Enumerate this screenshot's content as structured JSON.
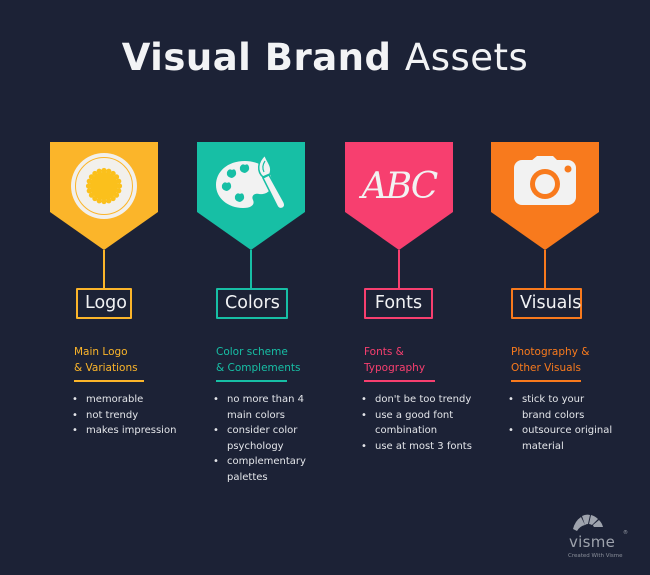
{
  "title": {
    "bold": "Visual Brand",
    "light": "Assets"
  },
  "colors": {
    "background": "#1c2236",
    "logo": "#fbb52a",
    "colors": "#17bfa5",
    "fonts": "#f73f6f",
    "visuals": "#f87a1d",
    "icon_white": "#f2f2f2"
  },
  "columns": [
    {
      "key": "logo",
      "icon": "sun-badge-icon",
      "label": "Logo",
      "subtitle_line1": "Main Logo",
      "subtitle_line2": "& Variations",
      "bullets": [
        "memorable",
        "not trendy",
        "makes impression"
      ]
    },
    {
      "key": "colors",
      "icon": "paint-palette-icon",
      "label": "Colors",
      "subtitle_line1": "Color scheme",
      "subtitle_line2": "& Complements",
      "bullets": [
        "no more than 4 main colors",
        "consider color psychology",
        "complementary palettes"
      ]
    },
    {
      "key": "fonts",
      "icon": "abc-text-icon",
      "icon_text": "ABC",
      "label": "Fonts",
      "subtitle_line1": "Fonts &",
      "subtitle_line2": "Typography",
      "bullets": [
        "don't be too trendy",
        "use a good font combination",
        "use at most 3 fonts"
      ]
    },
    {
      "key": "visuals",
      "icon": "camera-icon",
      "label": "Visuals",
      "subtitle_line1": "Photography &",
      "subtitle_line2": "Other Visuals",
      "bullets": [
        "stick to your brand colors",
        "outsource original material"
      ]
    }
  ],
  "branding": {
    "name": "visme",
    "registered": "®",
    "tagline": "Created With Visme"
  }
}
